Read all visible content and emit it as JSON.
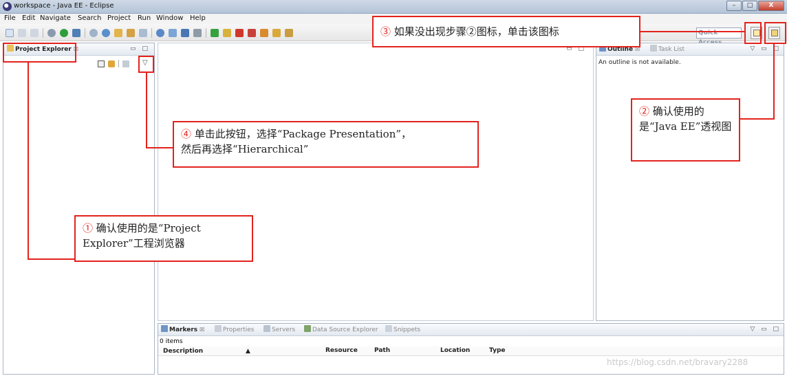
{
  "window": {
    "title": "workspace - Java EE - Eclipse",
    "min": "–",
    "max": "□",
    "close": "X"
  },
  "menu": [
    "File",
    "Edit",
    "Navigate",
    "Search",
    "Project",
    "Run",
    "Window",
    "Help"
  ],
  "toolbar": {
    "quick_access": "Quick Access"
  },
  "project_explorer": {
    "tab": "Project Explorer",
    "close": "☒",
    "min": "▭",
    "max": "□",
    "menu": "▽"
  },
  "editor": {
    "minmax": "▭ □"
  },
  "outline_view": {
    "tab_outline": "Outline",
    "tab_tasklist": "Task List",
    "message": "An outline is not available.",
    "close": "☒"
  },
  "markers_view": {
    "tabs": [
      "Markers",
      "Properties",
      "Servers",
      "Data Source Explorer",
      "Snippets"
    ],
    "count": "0 items",
    "columns": [
      "Description",
      "Resource",
      "Path",
      "Location",
      "Type"
    ]
  },
  "callouts": {
    "c1_num": "①",
    "c1_text": "确认使用的是“Project Explorer”工程浏览器",
    "c2_num": "②",
    "c2_text": "确认使用的是“Java EE”透视图",
    "c3_num": "③",
    "c3_text": "如果没出现步骤②图标，单击该图标",
    "c4_num": "④",
    "c4_line1": "单击此按钮，选择“Package Presentation”，",
    "c4_line2": "然后再选择“Hierarchical”"
  },
  "watermark": "https://blog.csdn.net/bravary2288",
  "colors": {
    "annotation_red": "#e3221c",
    "view_border": "#a8b4c3"
  }
}
